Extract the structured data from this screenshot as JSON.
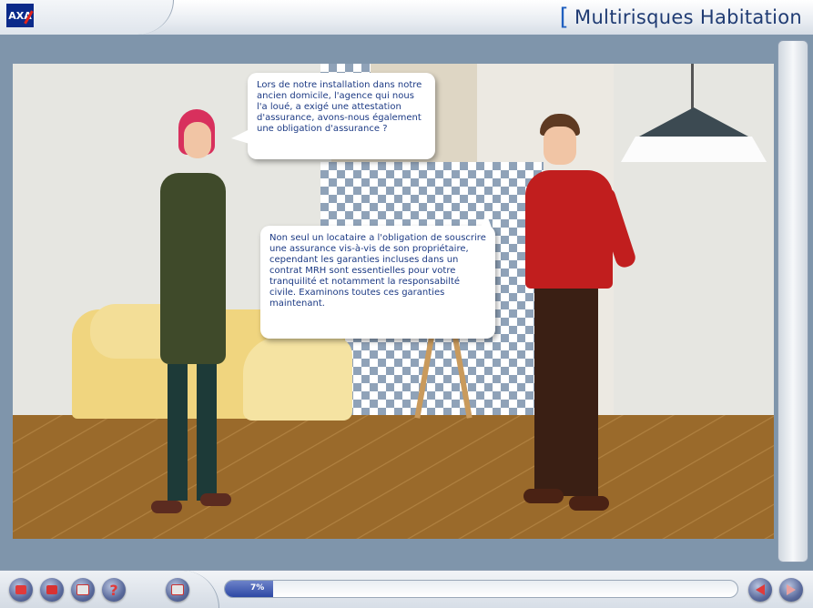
{
  "app": {
    "title": "Multirisques Habitation",
    "logo_text": "AXA"
  },
  "scene": {
    "woman_bubble": "Lors de notre installation dans notre ancien domicile, l'agence qui nous l'a loué, a exigé une attestation d'assurance, avons-nous également une obligation d'assurance ?",
    "man_bubble": "Non seul un locataire a l'obligation de souscrire une assurance vis-à-vis de son propriétaire, cependant les garanties incluses dans un contrat MRH sont essentielles pour votre tranquilité et notamment la responsabilté civile. Examinons toutes ces garanties maintenant."
  },
  "bottom": {
    "progress_value": 0.07,
    "progress_label": "7%",
    "buttons": [
      "home-icon",
      "book-icon",
      "print-icon",
      "help-icon",
      "exit-icon",
      "previous-icon",
      "next-icon"
    ]
  },
  "colors": {
    "accent": "#1f3b73",
    "brand_blue": "#0b2a8a",
    "brand_red": "#e2231a",
    "frame": "#7f95ab"
  }
}
